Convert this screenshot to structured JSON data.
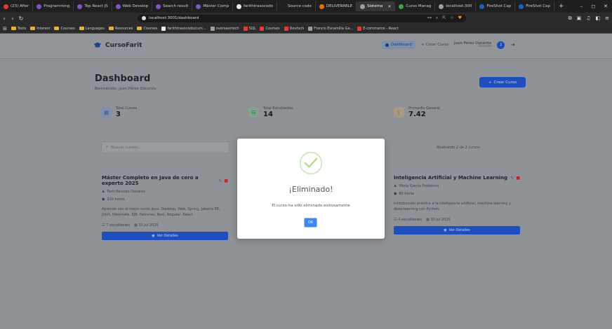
{
  "browser": {
    "tabs": [
      {
        "label": "(23) After",
        "color": "#e53935"
      },
      {
        "label": "Programming",
        "color": "#7e57c2"
      },
      {
        "label": "Top React JS",
        "color": "#7e57c2"
      },
      {
        "label": "Web Develop",
        "color": "#7e57c2"
      },
      {
        "label": "Search result",
        "color": "#7e57c2"
      },
      {
        "label": "Máster Comp",
        "color": "#7e57c2"
      },
      {
        "label": "farithtrasocodo",
        "color": "#eeeeee"
      },
      {
        "label": "Source code",
        "color": "#222222"
      },
      {
        "label": "DELIVERABLE",
        "color": "#ef6c00"
      },
      {
        "label": "Sistema",
        "color": "#9e9e9e",
        "active": true
      },
      {
        "label": "Curso Manag",
        "color": "#43a047"
      },
      {
        "label": "localhost:300",
        "color": "#9e9e9e"
      },
      {
        "label": "FireShot Cap",
        "color": "#1565c0"
      },
      {
        "label": "FireShot Cap",
        "color": "#1565c0"
      }
    ],
    "url": "localhost:3001/dashboard",
    "window_controls": {
      "minimize": "–",
      "maximize": "◻",
      "close": "✕"
    },
    "bookmarks": [
      {
        "label": "Tools",
        "type": "folder"
      },
      {
        "label": "Interest",
        "type": "folder"
      },
      {
        "label": "Courses",
        "type": "folder"
      },
      {
        "label": "Languages",
        "type": "folder"
      },
      {
        "label": "Resources",
        "type": "folder"
      },
      {
        "label": "Courses",
        "type": "folder"
      },
      {
        "label": "farithtrasocodo/curs...",
        "type": "github"
      },
      {
        "label": "oversaertech",
        "type": "site"
      },
      {
        "label": "SQL",
        "type": "youtube"
      },
      {
        "label": "Courses",
        "type": "youtube"
      },
      {
        "label": "Deutsch",
        "type": "youtube"
      },
      {
        "label": "Francis Escamilla Ga...",
        "type": "site"
      },
      {
        "label": "E-commerce - React",
        "type": "youtube"
      }
    ]
  },
  "header": {
    "brand": "CursoFarit",
    "dashboard_label": "Dashboard",
    "create_label": "Crear Curso",
    "user_name": "Juan Perez Docente",
    "user_role": "Docente",
    "avatar_initial": "J"
  },
  "page": {
    "title": "Dashboard",
    "subtitle": "Bienvenido, Juan Pérez Docente",
    "create_button": "Crear Curso",
    "search_placeholder": "Buscar cursos...",
    "showing": "Mostrando 2 de 2 cursos"
  },
  "stats": [
    {
      "label": "Total Cursos",
      "value": "3",
      "icon": "book-icon"
    },
    {
      "label": "Total Estudiantes",
      "value": "14",
      "icon": "users-icon"
    },
    {
      "label": "Promedio General",
      "value": "7.42",
      "icon": "chart-icon"
    }
  ],
  "courses": [
    {
      "title": "Máster Completo en Java de cero a experto 2025",
      "teacher": "Farit Reinoso Docente",
      "hours": "220 horas",
      "description": "Aprende con el mejor curso Java: Desktop, Web, Spring, Jakarta EE, JUnit, Hibernate, EJB, Patrones, Rest, Angular, React.",
      "students": "7 estudiantes",
      "date": "31 jul 2025",
      "button": "Ver Detalles"
    },
    {
      "title": "Inteligencia Artificial y Machine Learning",
      "teacher": "María García Profesora",
      "hours": "80 horas",
      "description": "Introducción práctica a la inteligencia artificial, machine learning y deep learning con Python.",
      "students": "4 estudiantes",
      "date": "30 jul 2025",
      "button": "Ver Detalles"
    }
  ],
  "modal": {
    "title": "¡Eliminado!",
    "text": "El curso ha sido eliminado exitosamente",
    "ok": "OK"
  },
  "colors": {
    "primary": "#1f4fbf",
    "success": "#a5dc86",
    "ok_button": "#3f86f0"
  }
}
